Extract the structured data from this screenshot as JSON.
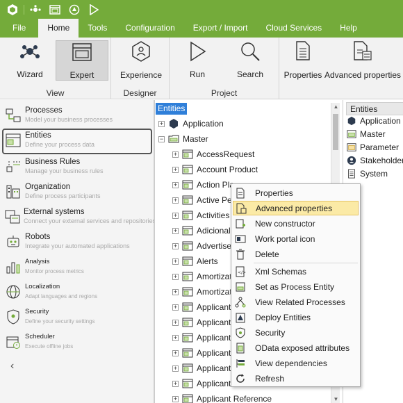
{
  "menu": {
    "tabs": [
      "File",
      "Home",
      "Tools",
      "Configuration",
      "Export / Import",
      "Cloud Services",
      "Help"
    ],
    "active": "Home"
  },
  "ribbon": {
    "wizard": "Wizard",
    "expert": "Expert",
    "experience": "Experience",
    "run": "Run",
    "search": "Search",
    "properties": "Properties",
    "advanced_properties": "Advanced properties",
    "group_view": "View",
    "group_designer": "Designer",
    "group_project": "Project"
  },
  "leftnav": {
    "items": [
      {
        "title": "Processes",
        "sub": "Model your business processes"
      },
      {
        "title": "Entities",
        "sub": "Define your process data"
      },
      {
        "title": "Business Rules",
        "sub": "Manage your business rules"
      },
      {
        "title": "Organization",
        "sub": "Define process participants"
      },
      {
        "title": "External systems",
        "sub": "Connect your external services and repositories"
      },
      {
        "title": "Robots",
        "sub": "Integrate your automated applications"
      },
      {
        "title": "Analysis",
        "sub": "Monitor process metrics"
      },
      {
        "title": "Localization",
        "sub": "Adapt languages and regions"
      },
      {
        "title": "Security",
        "sub": "Define your security settings"
      },
      {
        "title": "Scheduler",
        "sub": "Execute offline jobs"
      }
    ],
    "collapse": "‹"
  },
  "tree": {
    "header": "Entities",
    "application": "Application",
    "master": "Master",
    "entities": [
      "AccessRequest",
      "Account Product",
      "Action Pla",
      "Active Per",
      "Activities",
      "Adicional",
      "Advertiser",
      "Alerts",
      "Amortizati",
      "Amortizati",
      "Applicant",
      "Applicant",
      "Applicant",
      "Applicant",
      "Applicant",
      "Applicant",
      "Applicant Reference"
    ]
  },
  "rightpanel": {
    "header": "Entities",
    "items": [
      "Application",
      "Master",
      "Parameter",
      "Stakeholder",
      "System"
    ]
  },
  "context_menu": {
    "items": [
      "Properties",
      "Advanced properties",
      "New constructor",
      "Work portal icon",
      "Delete",
      "Xml Schemas",
      "Set as Process Entity",
      "View Related Processes",
      "Deploy Entities",
      "Security",
      "OData exposed attributes",
      "View dependencies",
      "Refresh"
    ],
    "highlighted": "Advanced properties"
  },
  "colors": {
    "brand_green": "#74ab3a",
    "selection_blue": "#2f7fd9",
    "menu_highlight": "#fbeaa6"
  }
}
